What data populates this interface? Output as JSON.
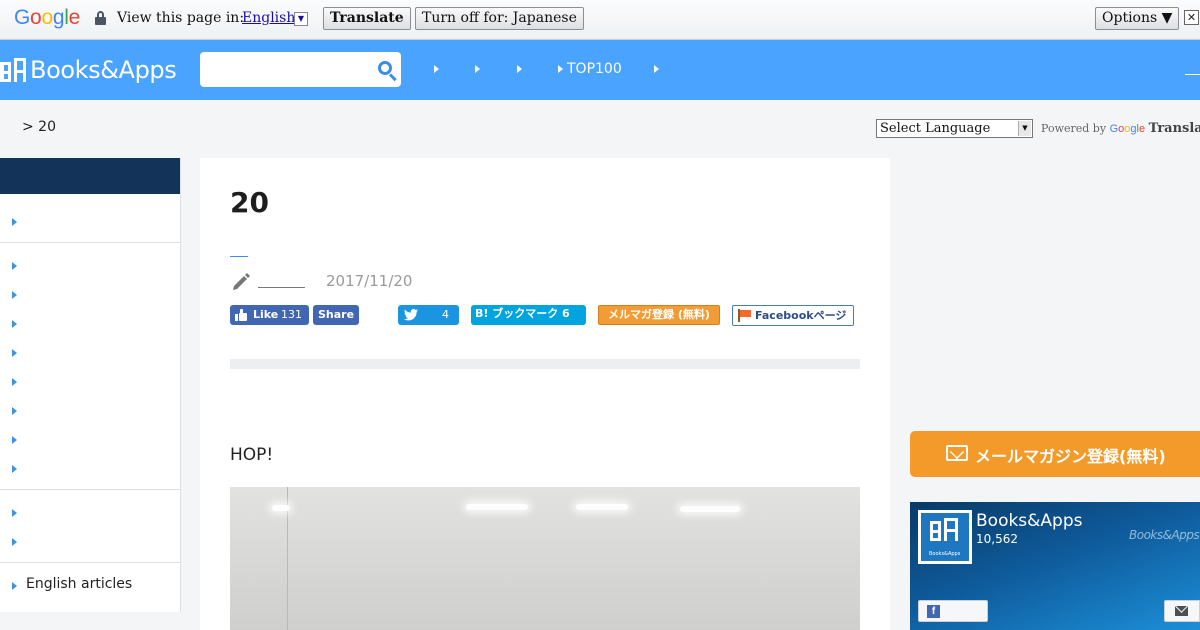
{
  "google_bar": {
    "logo": [
      "G",
      "o",
      "o",
      "g",
      "l",
      "e"
    ],
    "logo_colors": [
      "#4285f4",
      "#ea4335",
      "#fbbc05",
      "#4285f4",
      "#34a853",
      "#ea4335"
    ],
    "view_text": "View this page in:",
    "language": "English",
    "translate_btn": "Translate",
    "turn_off_btn": "Turn off for: Japanese",
    "options_btn": "Options ▼",
    "close_glyph": "✕"
  },
  "header": {
    "logo_text": "Books&Apps",
    "search_placeholder": "",
    "nav": [
      "",
      "",
      "",
      "TOP100",
      ""
    ],
    "brand_color": "#4aa3ff"
  },
  "breadcrumb": "> 20",
  "translate_widget": {
    "select_label": "Select Language",
    "powered_by": "Powered by",
    "google": "Google",
    "translate": "Translate"
  },
  "sidebar": {
    "bottom_item": "English articles"
  },
  "article": {
    "title": "20",
    "date": "2017/11/20",
    "share": {
      "like_label": "Like",
      "like_count": "131",
      "share_label": "Share",
      "tweet_count": "4",
      "hatena_label": "B! ブックマーク 6",
      "mail_label": "メルマガ登録 (無料)",
      "fb_page_label": "Facebookページ"
    },
    "intro": "HOP!"
  },
  "right_column": {
    "newsletter_label": "メールマガジン登録(無料)",
    "fb_widget": {
      "page_name": "Books&Apps",
      "followers": "10,562",
      "watermark": "Books&Apps",
      "avatar_caption": "Books&Apps"
    }
  }
}
